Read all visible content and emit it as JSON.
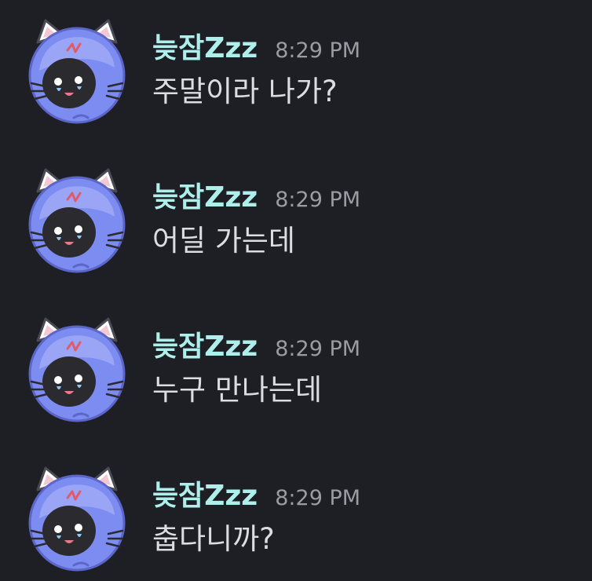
{
  "colors": {
    "background": "#1e1f24",
    "username": "#aeefeb",
    "timestamp": "#9b9ca3",
    "message_text": "#dcdde0",
    "avatar_blue": "#7c8cf0",
    "avatar_dark": "#2b2b2f",
    "ear_pink": "#f2c9d3"
  },
  "messages": [
    {
      "avatar_icon": "cat-hood-avatar-icon",
      "username": "늦잠Zzz",
      "timestamp": "8:29 PM",
      "text": "주말이라 나가?"
    },
    {
      "avatar_icon": "cat-hood-avatar-icon",
      "username": "늦잠Zzz",
      "timestamp": "8:29 PM",
      "text": "어딜 가는데"
    },
    {
      "avatar_icon": "cat-hood-avatar-icon",
      "username": "늦잠Zzz",
      "timestamp": "8:29 PM",
      "text": "누구 만나는데"
    },
    {
      "avatar_icon": "cat-hood-avatar-icon",
      "username": "늦잠Zzz",
      "timestamp": "8:29 PM",
      "text": "춥다니까?"
    }
  ]
}
